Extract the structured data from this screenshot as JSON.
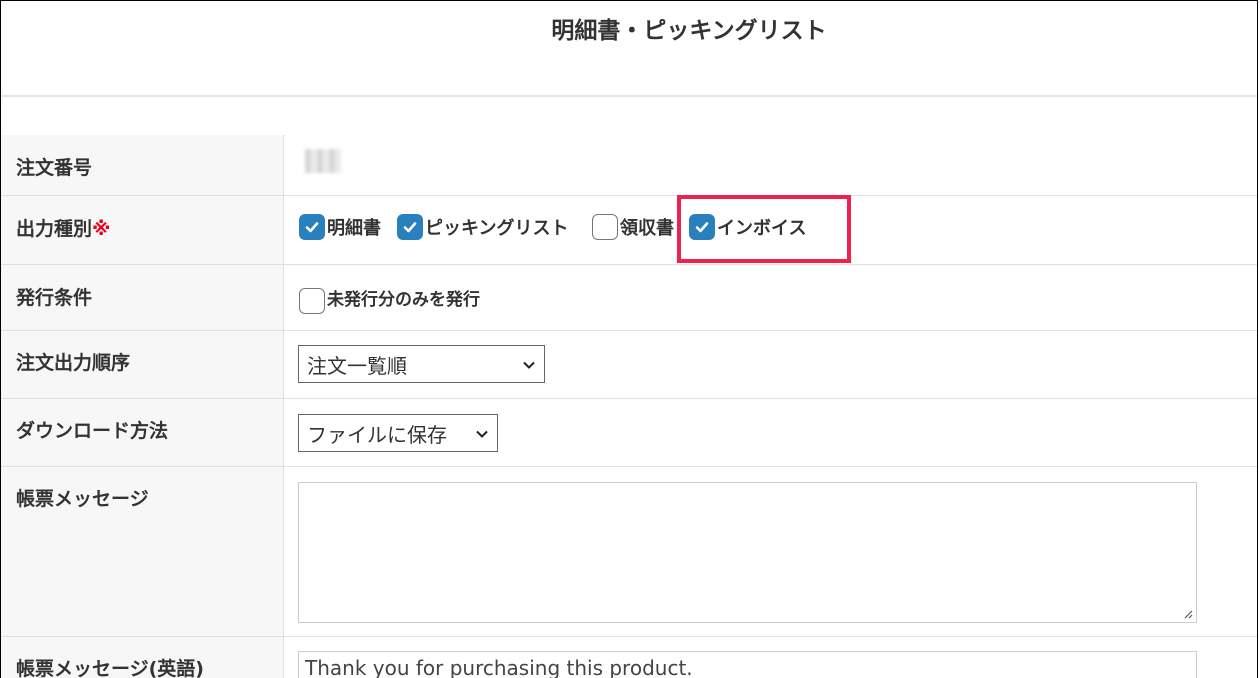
{
  "header": {
    "title": "明細書・ピッキングリスト"
  },
  "rows": {
    "order_number": {
      "label": "注文番号"
    },
    "output_type": {
      "label": "出力種別",
      "required_mark": "※",
      "options": [
        {
          "label": "明細書",
          "checked": true
        },
        {
          "label": "ピッキングリスト",
          "checked": true
        },
        {
          "label": "領収書",
          "checked": false
        },
        {
          "label": "インボイス",
          "checked": true
        }
      ]
    },
    "issue_condition": {
      "label": "発行条件",
      "option": {
        "label": "未発行分のみを発行",
        "checked": false
      }
    },
    "order_output_sort": {
      "label": "注文出力順序",
      "selected": "注文一覧順"
    },
    "download_method": {
      "label": "ダウンロード方法",
      "selected": "ファイルに保存"
    },
    "form_message": {
      "label": "帳票メッセージ",
      "value": ""
    },
    "form_message_en": {
      "label": "帳票メッセージ(英語)",
      "value": "Thank you for purchasing this product."
    }
  },
  "colors": {
    "checkbox_checked": "#2a7fbd",
    "highlight": "#f0204e",
    "required": "#e8001c"
  },
  "icons": {
    "check": "check-icon",
    "chevron": "chevron-down-icon",
    "resize": "resize-grip-icon"
  }
}
